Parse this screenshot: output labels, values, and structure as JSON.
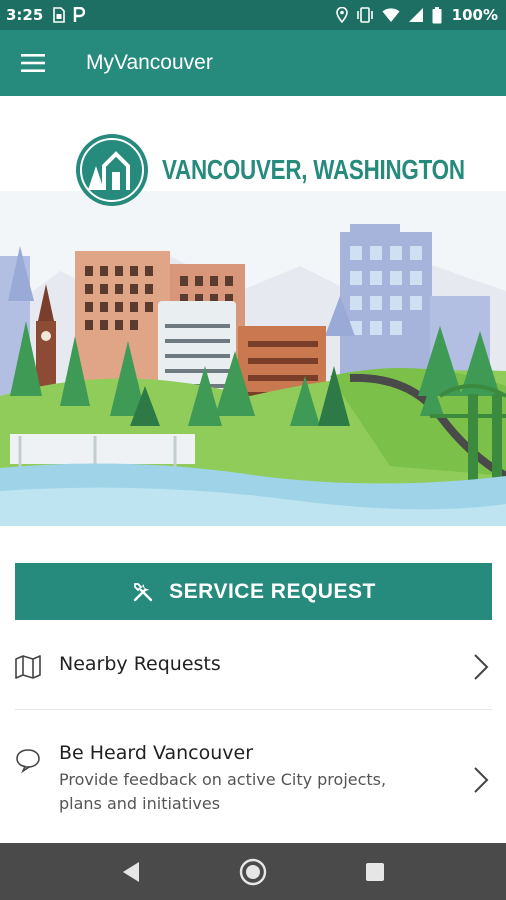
{
  "status_bar": {
    "time": "3:25",
    "battery": "100%",
    "left_icons": [
      "sim-card-icon",
      "parking-icon"
    ],
    "right_icons": [
      "location-icon",
      "vibrate-icon",
      "wifi-icon",
      "signal-icon",
      "battery-icon"
    ]
  },
  "app_bar": {
    "title": "MyVancouver",
    "menu_icon": "hamburger-menu-icon"
  },
  "hero": {
    "logo_text": "VANCOUVER, WASHINGTON"
  },
  "service_request": {
    "label": "SERVICE REQUEST",
    "icon": "tools-icon"
  },
  "list": [
    {
      "title": "Nearby Requests",
      "subtitle": "",
      "icon": "map-icon"
    },
    {
      "title": "Be Heard Vancouver",
      "subtitle": "Provide feedback on active City projects, plans and initiatives",
      "icon": "speech-bubble-icon"
    }
  ],
  "nav_bar": {
    "buttons": [
      "back",
      "home",
      "recents"
    ]
  },
  "colors": {
    "status_bar": "#1d6f64",
    "primary": "#268a7c",
    "nav_bar": "#4a4a4a"
  }
}
